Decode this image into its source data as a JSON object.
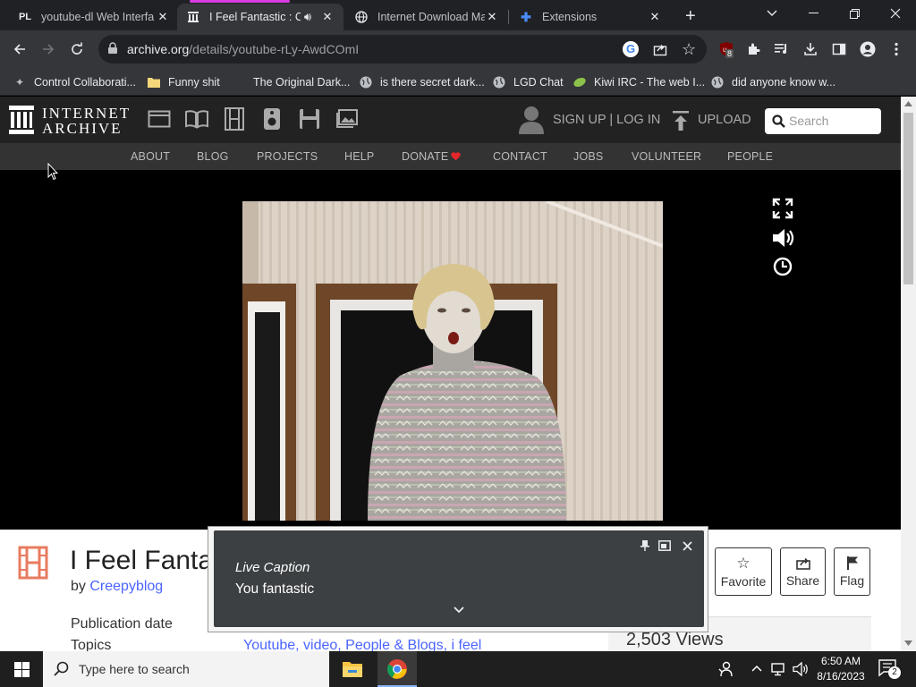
{
  "browser": {
    "tabs": [
      {
        "title": "youtube-dl Web Interfa",
        "icon": "PL"
      },
      {
        "title": "I Feel Fantastic : Cr",
        "icon": "archive-icon"
      },
      {
        "title": "Internet Download Ma",
        "icon": "globe-icon"
      },
      {
        "title": "Extensions",
        "icon": "puzzle-icon"
      }
    ],
    "url_host": "archive.org",
    "url_path": "/details/youtube-rLy-AwdCOmI",
    "extension_badge": "8",
    "bookmarks": [
      "Control Collaborati...",
      "Funny shit",
      "The Original Dark...",
      "is there secret dark...",
      "LGD Chat",
      "Kiwi IRC - The web I...",
      "did anyone know w..."
    ]
  },
  "ia": {
    "logo_line1": "INTERNET",
    "logo_line2": "ARCHIVE",
    "signup": "SIGN UP | LOG IN",
    "upload": "UPLOAD",
    "search_placeholder": "Search",
    "nav": [
      "ABOUT",
      "BLOG",
      "PROJECTS",
      "HELP",
      "DONATE",
      "CONTACT",
      "JOBS",
      "VOLUNTEER",
      "PEOPLE"
    ]
  },
  "item": {
    "title": "I Feel Fanta",
    "by_label": "by",
    "author": "Creepyblog",
    "pub_label": "Publication date",
    "topics_label": "Topics",
    "topics_value": "Youtube, video, People & Blogs, i feel",
    "views": "2,503 Views",
    "actions": [
      "Favorite",
      "Share",
      "Flag"
    ]
  },
  "caption": {
    "heading": "Live Caption",
    "text": "You fantastic"
  },
  "taskbar": {
    "search_placeholder": "Type here to search",
    "time": "6:50 AM",
    "date": "8/16/2023",
    "notifications": "2"
  },
  "colors": {
    "link": "#4b64ff",
    "media_indicator": "#d93cdf",
    "donate_heart": "#e4262c"
  }
}
